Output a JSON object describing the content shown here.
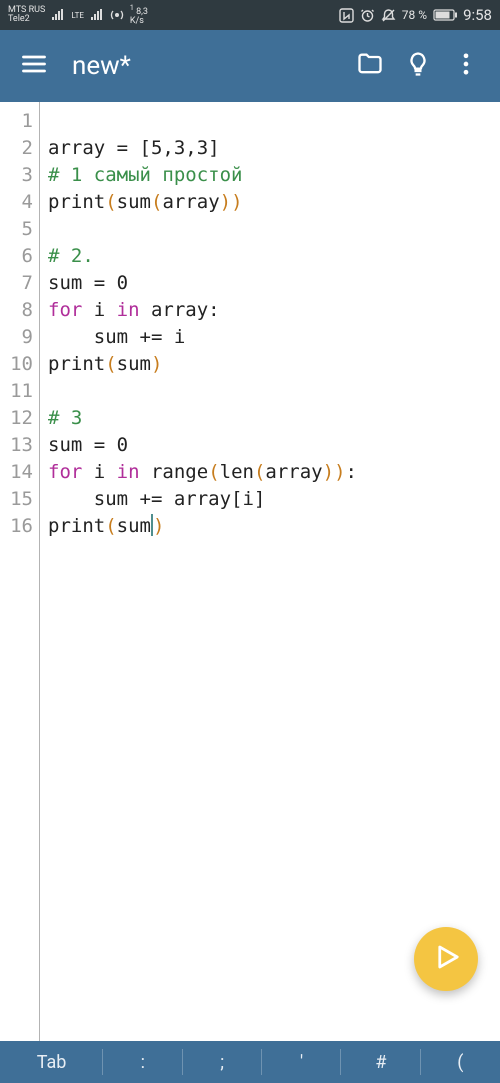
{
  "status": {
    "carrier1_top": "MTS RUS",
    "carrier1_bot": "Tele2",
    "lte": "LTE",
    "speed_top": "8,3",
    "speed_bot": "K/s",
    "speed_sup": "1",
    "battery": "78 %",
    "time": "9:58"
  },
  "toolbar": {
    "title": "new*"
  },
  "editor": {
    "lines": [
      {
        "num": "1",
        "tokens": []
      },
      {
        "num": "2",
        "tokens": [
          {
            "t": "array = [5,3,3]",
            "c": ""
          }
        ]
      },
      {
        "num": "3",
        "tokens": [
          {
            "t": "# 1 самый простой",
            "c": "c-comment"
          }
        ]
      },
      {
        "num": "4",
        "tokens": [
          {
            "t": "print",
            "c": ""
          },
          {
            "t": "(",
            "c": "c-paren-out"
          },
          {
            "t": "sum",
            "c": ""
          },
          {
            "t": "(",
            "c": "c-paren-in"
          },
          {
            "t": "array",
            "c": ""
          },
          {
            "t": ")",
            "c": "c-paren-in"
          },
          {
            "t": ")",
            "c": "c-paren-out"
          }
        ]
      },
      {
        "num": "5",
        "tokens": []
      },
      {
        "num": "6",
        "tokens": [
          {
            "t": "# 2.",
            "c": "c-comment"
          }
        ]
      },
      {
        "num": "7",
        "tokens": [
          {
            "t": "sum = 0",
            "c": ""
          }
        ]
      },
      {
        "num": "8",
        "tokens": [
          {
            "t": "for ",
            "c": "c-keyword"
          },
          {
            "t": "i ",
            "c": ""
          },
          {
            "t": "in ",
            "c": "c-keyword"
          },
          {
            "t": "array:",
            "c": ""
          }
        ]
      },
      {
        "num": "9",
        "tokens": [
          {
            "t": "    sum += i",
            "c": ""
          }
        ]
      },
      {
        "num": "10",
        "tokens": [
          {
            "t": "print",
            "c": ""
          },
          {
            "t": "(",
            "c": "c-paren-out"
          },
          {
            "t": "sum",
            "c": ""
          },
          {
            "t": ")",
            "c": "c-paren-out"
          }
        ]
      },
      {
        "num": "11",
        "tokens": []
      },
      {
        "num": "12",
        "tokens": [
          {
            "t": "# 3",
            "c": "c-comment"
          }
        ]
      },
      {
        "num": "13",
        "tokens": [
          {
            "t": "sum = 0",
            "c": ""
          }
        ]
      },
      {
        "num": "14",
        "tokens": [
          {
            "t": "for ",
            "c": "c-keyword"
          },
          {
            "t": "i ",
            "c": ""
          },
          {
            "t": "in ",
            "c": "c-keyword"
          },
          {
            "t": "range",
            "c": ""
          },
          {
            "t": "(",
            "c": "c-paren-out"
          },
          {
            "t": "len",
            "c": ""
          },
          {
            "t": "(",
            "c": "c-paren-in"
          },
          {
            "t": "array",
            "c": ""
          },
          {
            "t": ")",
            "c": "c-paren-in"
          },
          {
            "t": ")",
            "c": "c-paren-out"
          },
          {
            "t": ":",
            "c": ""
          }
        ]
      },
      {
        "num": "15",
        "tokens": [
          {
            "t": "    sum += array[i]",
            "c": ""
          }
        ]
      },
      {
        "num": "16",
        "tokens": [
          {
            "t": "print",
            "c": ""
          },
          {
            "t": "(",
            "c": "c-paren-out"
          },
          {
            "t": "sum",
            "c": ""
          },
          {
            "t": ")",
            "c": "c-paren-out"
          }
        ],
        "caret_before_last": true
      }
    ]
  },
  "keybar": {
    "keys": [
      "Tab",
      ":",
      ";",
      "'",
      "#",
      "("
    ]
  },
  "icons": {
    "menu": "menu-icon",
    "folder": "folder-icon",
    "bulb": "bulb-icon",
    "more": "more-vert-icon",
    "run": "play-icon",
    "nfc": "nfc-icon",
    "alarm": "alarm-icon",
    "silent": "silent-icon",
    "battery": "battery-icon",
    "signal": "signal-icon",
    "hotspot": "hotspot-icon"
  }
}
